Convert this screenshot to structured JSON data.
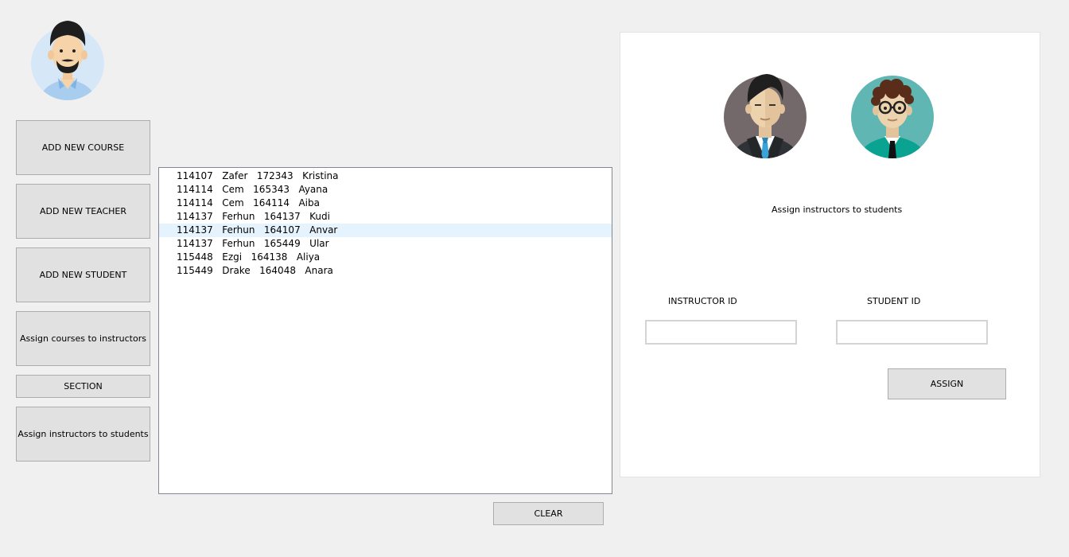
{
  "sidebar": {
    "buttons": [
      {
        "label": "ADD NEW COURSE"
      },
      {
        "label": "ADD NEW TEACHER"
      },
      {
        "label": "ADD NEW STUDENT"
      },
      {
        "label": "Assign courses to instructors"
      },
      {
        "label": "SECTION"
      },
      {
        "label": "Assign instructors to students"
      }
    ]
  },
  "list": {
    "rows": [
      {
        "instructor_id": "114107",
        "instructor": "Zafer",
        "student_id": "172343",
        "student": "Kristina"
      },
      {
        "instructor_id": "114114",
        "instructor": "Cem",
        "student_id": "165343",
        "student": "Ayana"
      },
      {
        "instructor_id": "114114",
        "instructor": "Cem",
        "student_id": "164114",
        "student": "Aiba"
      },
      {
        "instructor_id": "114137",
        "instructor": "Ferhun",
        "student_id": "164137",
        "student": "Kudi"
      },
      {
        "instructor_id": "114137",
        "instructor": "Ferhun",
        "student_id": "164107",
        "student": "Anvar"
      },
      {
        "instructor_id": "114137",
        "instructor": "Ferhun",
        "student_id": "165449",
        "student": "Ular"
      },
      {
        "instructor_id": "115448",
        "instructor": "Ezgi",
        "student_id": "164138",
        "student": "Aliya"
      },
      {
        "instructor_id": "115449",
        "instructor": "Drake",
        "student_id": "164048",
        "student": "Anara"
      }
    ],
    "selected_index": 4,
    "clear_label": "CLEAR"
  },
  "panel": {
    "title": "Assign instructors to students",
    "instructor_label": "INSTRUCTOR ID",
    "student_label": "STUDENT ID",
    "instructor_value": "",
    "student_value": "",
    "assign_label": "ASSIGN"
  },
  "colors": {
    "selection": "#e5f3ff",
    "button": "#e1e1e1",
    "background": "#f0f0f0"
  },
  "icons": {
    "admin": "admin-avatar-icon",
    "instructor": "instructor-avatar-icon",
    "student": "student-avatar-icon"
  }
}
